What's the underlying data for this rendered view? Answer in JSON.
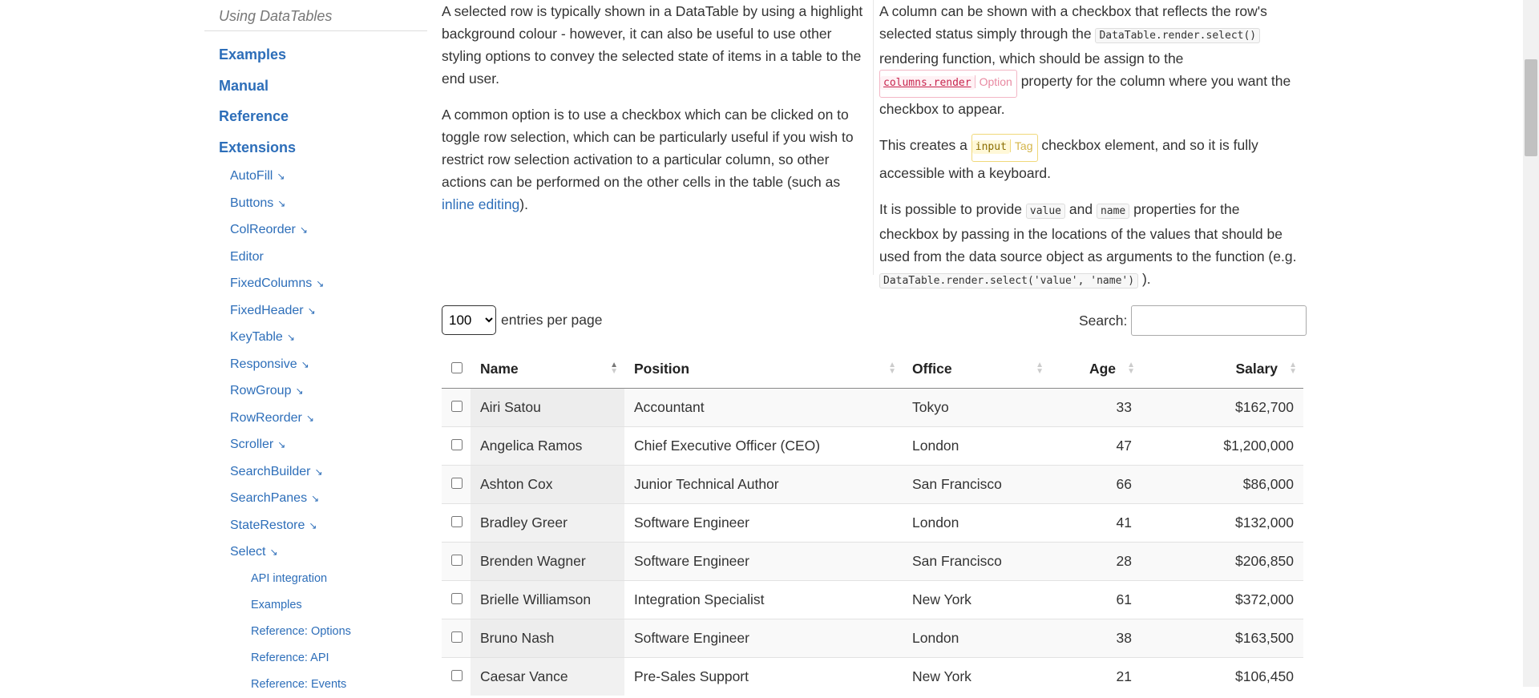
{
  "sidebar": {
    "using_label": "Using DataTables",
    "top_items": [
      "Examples",
      "Manual",
      "Reference",
      "Extensions"
    ],
    "extensions": [
      "AutoFill",
      "Buttons",
      "ColReorder",
      "Editor",
      "FixedColumns",
      "FixedHeader",
      "KeyTable",
      "Responsive",
      "RowGroup",
      "RowReorder",
      "Scroller",
      "SearchBuilder",
      "SearchPanes",
      "StateRestore",
      "Select"
    ],
    "select_sub": [
      "API integration",
      "Examples",
      "Reference: Options",
      "Reference: API",
      "Reference: Events"
    ],
    "arrow_glyph": "↘"
  },
  "intro": {
    "left_p1": "A selected row is typically shown in a DataTable by using a highlight background colour - however, it can also be useful to use other styling options to convey the selected state of items in a table to the end user.",
    "left_p2_before": "A common option is to use a checkbox which can be clicked on to toggle row selection, which can be particularly useful if you wish to restrict row selection activation to a particular column, so other actions can be performed on the other cells in the table (such as ",
    "left_p2_link": "inline editing",
    "left_p2_after": ").",
    "right_p1_a": "A column can be shown with a checkbox that reflects the row's selected status simply through the ",
    "right_p1_code": "DataTable.render.select()",
    "right_p1_b": " rendering function, which should be assign to the ",
    "right_p1_tag": "columns.render",
    "right_p1_tag_type": "Option",
    "right_p1_c": " property for the column where you want the checkbox to appear.",
    "right_p2_a": "This creates a ",
    "right_p2_tag": "input",
    "right_p2_tag_type": "Tag",
    "right_p2_b": " checkbox element, and so it is fully accessible with a keyboard.",
    "right_p3_a": "It is possible to provide ",
    "right_p3_code1": "value",
    "right_p3_b": " and ",
    "right_p3_code2": "name",
    "right_p3_c": " properties for the checkbox by passing in the locations of the values that should be used from the data source object as arguments to the function (e.g. ",
    "right_p3_code3": "DataTable.render.select('value', 'name')",
    "right_p3_d": " )."
  },
  "controls": {
    "page_length_value": "100",
    "entries_label": "entries per page",
    "search_label": "Search:",
    "search_value": ""
  },
  "table": {
    "headers": [
      "Name",
      "Position",
      "Office",
      "Age",
      "Salary"
    ],
    "rows": [
      [
        "Airi Satou",
        "Accountant",
        "Tokyo",
        "33",
        "$162,700"
      ],
      [
        "Angelica Ramos",
        "Chief Executive Officer (CEO)",
        "London",
        "47",
        "$1,200,000"
      ],
      [
        "Ashton Cox",
        "Junior Technical Author",
        "San Francisco",
        "66",
        "$86,000"
      ],
      [
        "Bradley Greer",
        "Software Engineer",
        "London",
        "41",
        "$132,000"
      ],
      [
        "Brenden Wagner",
        "Software Engineer",
        "San Francisco",
        "28",
        "$206,850"
      ],
      [
        "Brielle Williamson",
        "Integration Specialist",
        "New York",
        "61",
        "$372,000"
      ],
      [
        "Bruno Nash",
        "Software Engineer",
        "London",
        "38",
        "$163,500"
      ],
      [
        "Caesar Vance",
        "Pre-Sales Support",
        "New York",
        "21",
        "$106,450"
      ]
    ]
  }
}
